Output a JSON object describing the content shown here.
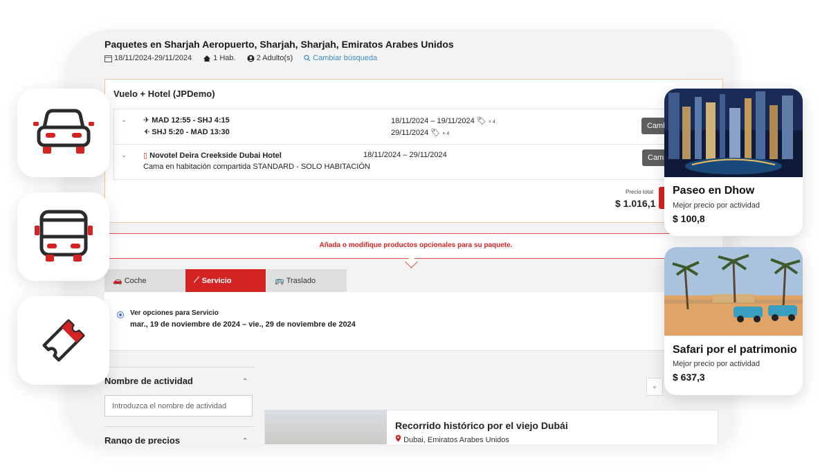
{
  "header": {
    "title": "Paquetes en Sharjah Aeropuerto, Sharjah, Sharjah, Emiratos Arabes Unidos",
    "dates": "18/11/2024-29/11/2024",
    "rooms": "1 Hab.",
    "adults": "2 Adulto(s)",
    "change_search": "Cambiar búsqueda"
  },
  "package": {
    "title": "Vuelo + Hotel (JPDemo)",
    "flight": {
      "outbound": "MAD 12:55 - SHJ 4:15",
      "return": "SHJ 5:20 - MAD 13:30",
      "outbound_dates": "18/11/2024 – 19/11/2024",
      "return_dates": "29/11/2024",
      "luggage": "× 4",
      "change_button": "Cambiar"
    },
    "hotel": {
      "name": "Novotel Deira Creekside Dubai Hotel",
      "dates": "18/11/2024 – 29/11/2024",
      "room": "Cama en habitación compartida STANDARD - SOLO HABITACIÓN",
      "change_button": "Cambiar"
    },
    "total_label": "Precio total",
    "total_value": "$ 1.016,1"
  },
  "optional": {
    "banner": "Añada o modifique productos opcionales para su paquete."
  },
  "tabs": [
    {
      "label": "Coche"
    },
    {
      "label": "Servicio"
    },
    {
      "label": "Traslado"
    }
  ],
  "service": {
    "option": "Ver opciones para Servicio",
    "dates": "mar., 19 de noviembre de 2024 – vie., 29 de noviembre de 2024"
  },
  "filters": {
    "name_heading": "Nombre de actividad",
    "name_placeholder": "Introduzca el nombre de actividad",
    "price_heading": "Rango de precios"
  },
  "pager": {
    "prev": "«"
  },
  "result": {
    "title": "Recorrido histórico por el viejo Dubái",
    "location": "Dubai, Emiratos Arabes Unidos"
  },
  "side_icons": [
    "car-front-icon",
    "bus-front-icon",
    "ticket-icon"
  ],
  "promos": [
    {
      "title": "Paseo en Dhow",
      "subtitle": "Mejor precio por actividad",
      "price": "$ 100,8"
    },
    {
      "title": "Safari por el patrimonio",
      "subtitle": "Mejor precio por actividad",
      "price": "$ 637,3"
    }
  ],
  "colors": {
    "accent": "#d32323",
    "link": "#3a8fc7",
    "icon_dark": "#2b2b2b"
  }
}
